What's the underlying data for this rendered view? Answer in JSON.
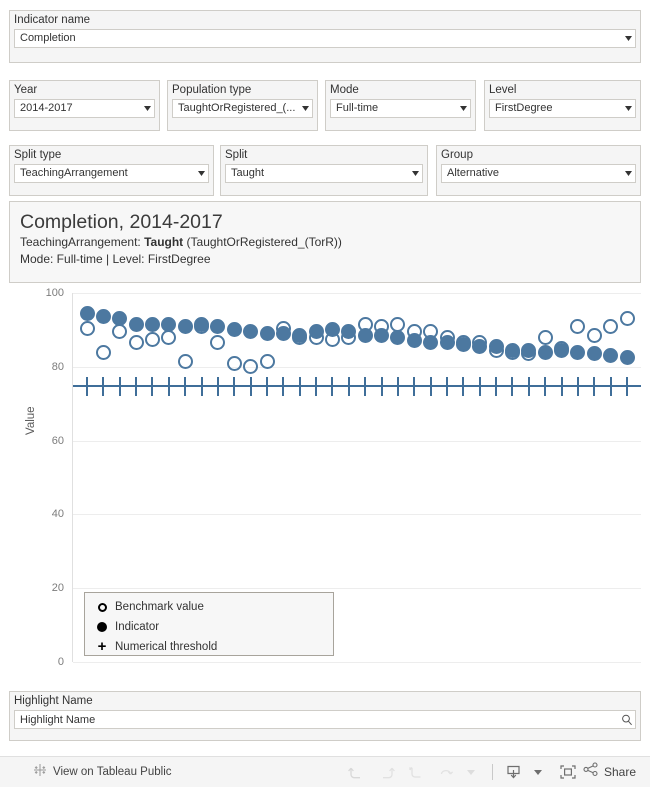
{
  "filters": {
    "indicator": {
      "label": "Indicator name",
      "value": "Completion"
    },
    "year": {
      "label": "Year",
      "value": "2014-2017"
    },
    "population_type": {
      "label": "Population type",
      "value": "TaughtOrRegistered_(..."
    },
    "mode": {
      "label": "Mode",
      "value": "Full-time"
    },
    "level": {
      "label": "Level",
      "value": "FirstDegree"
    },
    "split_type": {
      "label": "Split type",
      "value": "TeachingArrangement"
    },
    "split": {
      "label": "Split",
      "value": "Taught"
    },
    "group": {
      "label": "Group",
      "value": "Alternative"
    }
  },
  "title": {
    "main": "Completion, 2014-2017",
    "line2_prefix": "TeachingArrangement: ",
    "line2_bold": "Taught",
    "line2_suffix": " (TaughtOrRegistered_(TorR))",
    "line3": "Mode: Full-time | Level: FirstDegree"
  },
  "highlight": {
    "label": "Highlight Name",
    "placeholder": "Highlight Name",
    "value": "",
    "icon": "search-icon"
  },
  "toolbar": {
    "tableau_label": "View on Tableau Public",
    "tableau_icon": "tableau-logo-icon",
    "undo_icon": "undo-icon",
    "redo_icon": "redo-icon",
    "revert_icon": "revert-icon",
    "refresh_icon": "refresh-icon",
    "refresh_caret_icon": "chevron-down-icon",
    "download_icon": "download-icon",
    "download_caret_icon": "chevron-down-icon",
    "fullscreen_icon": "fullscreen-icon",
    "share_icon": "share-icon",
    "share_label": "Share"
  },
  "chart_data": {
    "type": "scatter",
    "title": "Completion, 2014-2017",
    "xlabel": "",
    "ylabel": "Value",
    "ylim": [
      0,
      100
    ],
    "yticks": [
      0,
      20,
      40,
      60,
      80,
      100
    ],
    "grid": true,
    "legend_position": "inside-bottom-left",
    "accent_color": "#4c78a0",
    "threshold_color": "#3f6e99",
    "legend": [
      {
        "marker": "open-circle",
        "label": "Benchmark value",
        "name": "benchmark-value"
      },
      {
        "marker": "filled-circle",
        "label": "Indicator",
        "name": "indicator"
      },
      {
        "marker": "plus",
        "label": "Numerical threshold",
        "name": "numerical-threshold"
      }
    ],
    "numerical_threshold": 75,
    "series": [
      {
        "name": "Indicator",
        "marker": "filled-circle",
        "values": [
          94.5,
          93.5,
          93.0,
          91.5,
          91.5,
          91.5,
          91.0,
          91.5,
          91.0,
          90.0,
          89.5,
          89.0,
          89.0,
          88.5,
          89.5,
          90.0,
          89.5,
          88.5,
          88.5,
          88.0,
          87.0,
          86.5,
          86.5,
          86.0,
          85.5,
          85.5,
          84.5,
          84.5,
          84.0,
          84.5,
          84.0,
          83.5,
          83.0,
          82.5
        ]
      },
      {
        "name": "Benchmark value",
        "marker": "open-circle",
        "values": [
          90.5,
          84.0,
          89.5,
          86.5,
          87.5,
          88.0,
          81.5,
          91.0,
          86.5,
          81.0,
          80.0,
          81.5,
          90.5,
          88.0,
          88.0,
          87.5,
          88.0,
          91.5,
          91.0,
          91.5,
          89.5,
          89.5,
          88.0,
          86.5,
          86.5,
          84.5,
          84.0,
          83.5,
          88.0,
          85.0,
          91.0,
          88.5,
          91.0,
          93.0
        ]
      }
    ],
    "n_points": 34
  }
}
